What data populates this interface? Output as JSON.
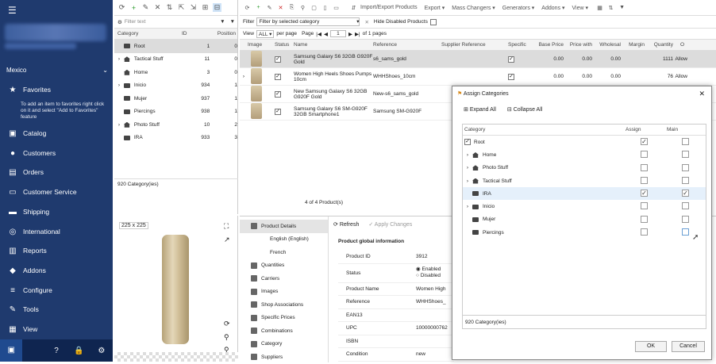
{
  "nav": {
    "country": "Mexico",
    "items": [
      {
        "label": "Favorites",
        "icon": "star-icon"
      },
      {
        "label": "Catalog",
        "icon": "catalog-icon"
      },
      {
        "label": "Customers",
        "icon": "customers-icon"
      },
      {
        "label": "Orders",
        "icon": "orders-icon"
      },
      {
        "label": "Customer Service",
        "icon": "customer-service-icon"
      },
      {
        "label": "Shipping",
        "icon": "shipping-icon"
      },
      {
        "label": "International",
        "icon": "globe-icon"
      },
      {
        "label": "Reports",
        "icon": "reports-icon"
      },
      {
        "label": "Addons",
        "icon": "addons-icon"
      },
      {
        "label": "Configure",
        "icon": "configure-icon"
      },
      {
        "label": "Tools",
        "icon": "tools-icon"
      },
      {
        "label": "View",
        "icon": "view-icon"
      }
    ],
    "favorites_tip": "To add an item to favorites right click on it and select \"Add to Favorites\" feature"
  },
  "categories": {
    "filter_placeholder": "Filter text",
    "headers": {
      "category": "Category",
      "id": "ID",
      "position": "Position"
    },
    "rows": [
      {
        "name": "Root",
        "id": "1",
        "pos": "0",
        "icon": "folder"
      },
      {
        "name": "Tactical Stuff",
        "id": "11",
        "pos": "0",
        "icon": "home"
      },
      {
        "name": "Home",
        "id": "3",
        "pos": "0",
        "icon": "home"
      },
      {
        "name": "Inicio",
        "id": "934",
        "pos": "1",
        "icon": "folder"
      },
      {
        "name": "Mujer",
        "id": "937",
        "pos": "1",
        "icon": "folder"
      },
      {
        "name": "Piercings",
        "id": "938",
        "pos": "1",
        "icon": "folder"
      },
      {
        "name": "Photo Stuff",
        "id": "10",
        "pos": "2",
        "icon": "home"
      },
      {
        "name": "IRA",
        "id": "933",
        "pos": "3",
        "icon": "folder"
      }
    ],
    "count": "920 Category(ies)"
  },
  "toolbar": {
    "import_export": "Import/Export Products",
    "export": "Export",
    "mass_changers": "Mass Changers",
    "generators": "Generators",
    "addons": "Addons",
    "view": "View"
  },
  "products": {
    "filter_label": "Filter",
    "filter_value": "Filter by selected category",
    "hide_disabled": "Hide Disabled Products",
    "view_label": "View",
    "view_value": "ALL",
    "per_page": "per page",
    "page_label": "Page",
    "page_value": "1",
    "of_pages": "of 1 pages",
    "headers": {
      "image": "Image",
      "status": "Status",
      "name": "Name",
      "reference": "Reference",
      "supplier_ref": "Supplier Reference",
      "specific": "Specific",
      "base_price": "Base Price",
      "price_with": "Price with",
      "wholesale": "Wholesal",
      "margin": "Margin",
      "quantity": "Quantity",
      "o": "O"
    },
    "rows": [
      {
        "name": "Samsung Galaxy S6 32GB G920F Gold",
        "ref": "s6_sams_gold",
        "base": "0.00",
        "pw": "0.00",
        "ws": "0.00",
        "qty": "1111",
        "extra": "Allow"
      },
      {
        "name": "Women High Heels Shoes Pumps 10cm",
        "ref": "WHHShoes_10cm",
        "base": "0.00",
        "pw": "0.00",
        "ws": "0.00",
        "qty": "76",
        "extra": "Allow"
      },
      {
        "name": "New Samsung Galaxy S6 32GB G920F Gold",
        "ref": "New-s6_sams_gold",
        "base": "",
        "pw": "",
        "ws": "",
        "qty": "",
        "extra": ""
      },
      {
        "name": "Samsung Galaxy S6 SM-G920F 32GB Smartphone1",
        "ref": "Samsung SM-G920F",
        "base": "",
        "pw": "",
        "ws": "",
        "qty": "",
        "extra": ""
      }
    ],
    "count": "4 of 4 Product(s)"
  },
  "preview": {
    "size": "225 x 225"
  },
  "details": {
    "nav": [
      {
        "label": "Product Details",
        "sub": false
      },
      {
        "label": "English (English)",
        "sub": true
      },
      {
        "label": "French",
        "sub": true
      },
      {
        "label": "Quantities",
        "sub": false
      },
      {
        "label": "Carriers",
        "sub": false
      },
      {
        "label": "Images",
        "sub": false
      },
      {
        "label": "Shop Associations",
        "sub": false
      },
      {
        "label": "Specific Prices",
        "sub": false
      },
      {
        "label": "Combinations",
        "sub": false
      },
      {
        "label": "Category",
        "sub": false
      },
      {
        "label": "Suppliers",
        "sub": false
      }
    ],
    "refresh": "Refresh",
    "apply": "Apply Changes",
    "section": "Product global information",
    "fields": [
      {
        "k": "Product ID",
        "v": "3912"
      },
      {
        "k": "Status",
        "v": "Enabled"
      },
      {
        "k": "Product Name",
        "v": "Women High"
      },
      {
        "k": "Reference",
        "v": "WHHShoes_"
      },
      {
        "k": "EAN13",
        "v": ""
      },
      {
        "k": "UPC",
        "v": "10000000762"
      },
      {
        "k": "ISBN",
        "v": ""
      },
      {
        "k": "Condition",
        "v": "new"
      }
    ],
    "status_disabled": "Disabled"
  },
  "dialog": {
    "title": "Assign Categories",
    "expand": "Expand All",
    "collapse": "Collapse All",
    "headers": {
      "category": "Category",
      "assign": "Assign",
      "main": "Main"
    },
    "rows": [
      {
        "name": "Root",
        "icon": "checkbox",
        "expander": false,
        "assign": true,
        "main": false
      },
      {
        "name": "Home",
        "icon": "home",
        "expander": true,
        "assign": false,
        "main": false
      },
      {
        "name": "Photo Stuff",
        "icon": "home",
        "expander": true,
        "assign": false,
        "main": false
      },
      {
        "name": "Tactical Stuff",
        "icon": "home",
        "expander": true,
        "assign": false,
        "main": false
      },
      {
        "name": "IRA",
        "icon": "folder",
        "expander": false,
        "assign": true,
        "main": true
      },
      {
        "name": "Inicio",
        "icon": "folder",
        "expander": true,
        "assign": false,
        "main": false
      },
      {
        "name": "Mujer",
        "icon": "folder",
        "expander": false,
        "assign": false,
        "main": false
      },
      {
        "name": "Piercings",
        "icon": "folder",
        "expander": false,
        "assign": false,
        "main": false
      }
    ],
    "count": "920 Category(ies)",
    "ok": "OK",
    "cancel": "Cancel"
  }
}
